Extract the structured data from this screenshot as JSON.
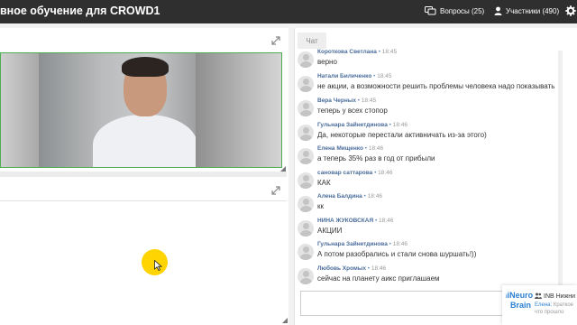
{
  "window": {
    "title": "вное обучение для CROWD1"
  },
  "toolbar": {
    "questions_label": "Вопросы (25)",
    "participants_label": "Участники (490)",
    "icons": [
      "questions-icon",
      "participants-icon",
      "gear-icon"
    ]
  },
  "chat": {
    "tab_label": "Чат",
    "messages": [
      {
        "author": "Короткова Светлана",
        "time": "18:45",
        "text": "верно"
      },
      {
        "author": "Натали Биличенко",
        "time": "18:45",
        "text": "не акции, а возможности решить проблемы человека надо показывать"
      },
      {
        "author": "Вера Черных",
        "time": "18:45",
        "text": "теперь у всех стопор"
      },
      {
        "author": "Гульнара Зайнетдинова",
        "time": "18:46",
        "text": "Да, некоторые перестали активничать из-за этого)"
      },
      {
        "author": "Елена Мищенко",
        "time": "18:46",
        "text": "а теперь 35% раз в год от прибыли"
      },
      {
        "author": "сановар саттарова",
        "time": "18:46",
        "text": "КАК"
      },
      {
        "author": "Алена Балдина",
        "time": "18:46",
        "text": "кк"
      },
      {
        "author": "НИНА ЖУКОВСКАЯ",
        "time": "18:46",
        "text": "АКЦИИ"
      },
      {
        "author": "Гульнара Зайнетдинова",
        "time": "18:46",
        "text": "А потом разобрались и стали снова шуршать!))"
      },
      {
        "author": "Любовь Хромых",
        "time": "18:46",
        "text": "сейчас на планету аикс приглашаем"
      }
    ]
  },
  "brand_popup": {
    "logo_line1": "iNeuro",
    "logo_line2": "Brain",
    "name": "INB Нижни",
    "snippet_author": "Елена:",
    "snippet_text": "Краткое",
    "snippet_line2": "что прошло"
  },
  "colors": {
    "topbar": "#2f2f2f",
    "video_border": "#4caf50",
    "author": "#4a6c9b",
    "highlight": "#ffd400"
  }
}
